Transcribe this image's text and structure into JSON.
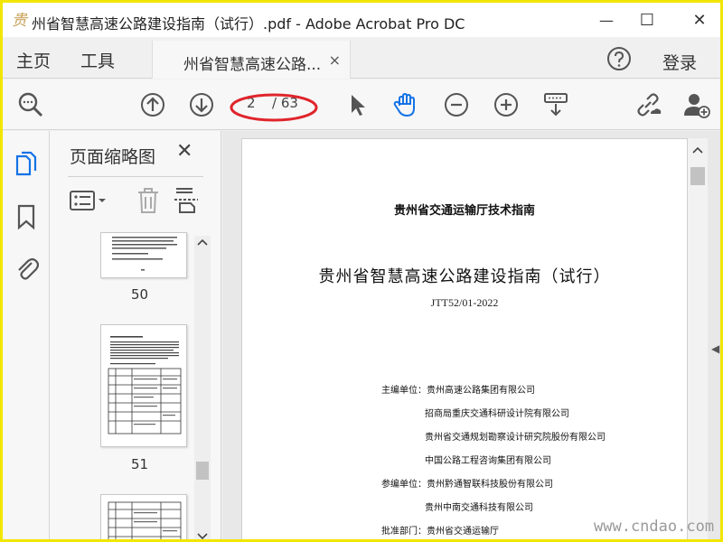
{
  "window": {
    "title": "州省智慧高速公路建设指南（试行）.pdf - Adobe Acrobat Pro DC",
    "minimize_glyph": "—",
    "maximize_glyph": "☐",
    "close_glyph": "✕"
  },
  "menubar": {
    "home": "主页",
    "tools": "工具",
    "document_tab": "州省智慧高速公路...",
    "tab_close": "×",
    "login": "登录"
  },
  "toolbar": {
    "page_current": "2",
    "page_total": "/ 63"
  },
  "thumbnails_panel": {
    "title": "页面缩略图",
    "close": "✕",
    "pages": [
      {
        "number": "50"
      },
      {
        "number": "51"
      }
    ]
  },
  "document": {
    "publisher": "贵州省交通运输厅技术指南",
    "title": "贵州省智慧高速公路建设指南（试行）",
    "code": "JTT52/01-2022",
    "lines": [
      "主编单位：贵州高速公路集团有限公司",
      "招商局重庆交通科研设计院有限公司",
      "贵州省交通规划勘察设计研究院股份有限公司",
      "中国公路工程咨询集团有限公司",
      "参编单位：贵州黔通智联科技股份有限公司",
      "贵州中南交通科技有限公司",
      "批准部门：贵州省交通运输厅"
    ]
  },
  "watermark": "www.cndao.com",
  "colors": {
    "accent_blue": "#1473e6",
    "annotation_red": "#e0242b",
    "frame_yellow": "#f2e600"
  }
}
